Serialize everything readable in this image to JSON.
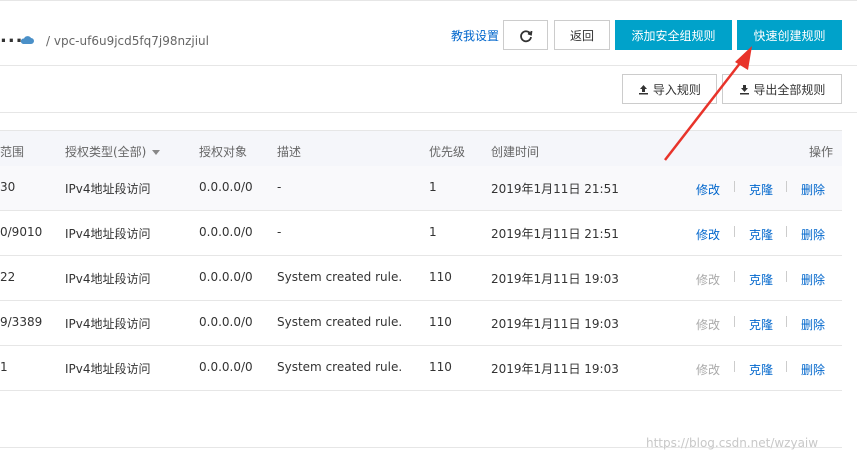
{
  "header": {
    "title_fragment": "...",
    "vpc_text": "/ vpc-uf6u9jcd5fq7j98nzjiul",
    "help_link": "教我设置",
    "refresh_icon": "refresh-icon",
    "back_label": "返回",
    "add_rule_label": "添加安全组规则",
    "quick_create_label": "快速创建规则"
  },
  "toolbar": {
    "import_label": "导入规则",
    "export_label": "导出全部规则",
    "import_icon": "upload-icon",
    "export_icon": "download-icon"
  },
  "table": {
    "columns": [
      "范围",
      "授权类型(全部)",
      "授权对象",
      "描述",
      "优先级",
      "创建时间",
      "操作"
    ],
    "rows": [
      {
        "range": "30",
        "type": "IPv4地址段访问",
        "object": "0.0.0.0/0",
        "desc": "-",
        "priority": "1",
        "created": "2019年1月11日 21:51",
        "edit": "修改",
        "clone": "克隆",
        "delete": "删除",
        "edit_enabled": true
      },
      {
        "range": "0/9010",
        "type": "IPv4地址段访问",
        "object": "0.0.0.0/0",
        "desc": "-",
        "priority": "1",
        "created": "2019年1月11日 21:51",
        "edit": "修改",
        "clone": "克隆",
        "delete": "删除",
        "edit_enabled": true
      },
      {
        "range": "22",
        "type": "IPv4地址段访问",
        "object": "0.0.0.0/0",
        "desc": "System created rule.",
        "priority": "110",
        "created": "2019年1月11日 19:03",
        "edit": "修改",
        "clone": "克隆",
        "delete": "删除",
        "edit_enabled": false
      },
      {
        "range": "9/3389",
        "type": "IPv4地址段访问",
        "object": "0.0.0.0/0",
        "desc": "System created rule.",
        "priority": "110",
        "created": "2019年1月11日 19:03",
        "edit": "修改",
        "clone": "克隆",
        "delete": "删除",
        "edit_enabled": false
      },
      {
        "range": "1",
        "type": "IPv4地址段访问",
        "object": "0.0.0.0/0",
        "desc": "System created rule.",
        "priority": "110",
        "created": "2019年1月11日 19:03",
        "edit": "修改",
        "clone": "克隆",
        "delete": "删除",
        "edit_enabled": false
      }
    ]
  },
  "watermark": "https://blog.csdn.net/wzyaiw",
  "colors": {
    "primary": "#00a2ca",
    "link": "#0066cc",
    "disabled": "#aaaaaa",
    "annotation_arrow": "#e8332a"
  }
}
